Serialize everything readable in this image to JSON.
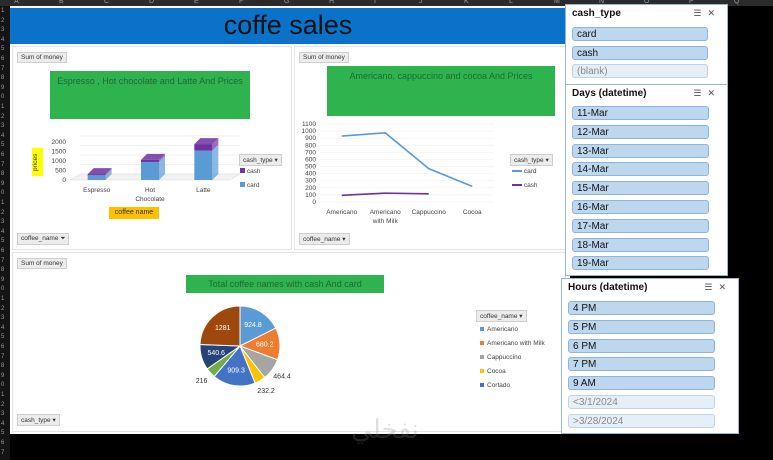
{
  "spreadsheet": {
    "column_letters": [
      "A",
      "B",
      "C",
      "D",
      "E",
      "F",
      "G",
      "H",
      "I",
      "J",
      "K",
      "L",
      "M",
      "N",
      "O",
      "P",
      "Q"
    ],
    "row_numbers": [
      "1",
      "2",
      "3",
      "4",
      "5",
      "6",
      "7",
      "8",
      "9",
      "0",
      "1",
      "2",
      "3",
      "4",
      "5",
      "6",
      "7",
      "8",
      "9",
      "0",
      "1",
      "2",
      "3",
      "4",
      "5",
      "6",
      "7",
      "8",
      "9",
      "0",
      "1",
      "2",
      "3",
      "4",
      "5",
      "6",
      "7",
      "8",
      "9",
      "0",
      "1",
      "2",
      "3",
      "4",
      "5",
      "6",
      "7"
    ]
  },
  "dashboard": {
    "title": "coffe sales",
    "field_sum_of_money": "Sum of money",
    "field_coffee_name": "coffee_name",
    "field_cash_type": "cash_type",
    "filter_glyph": "▾",
    "funnel_glyph": "⏷"
  },
  "chart1": {
    "title": "Espresso , Hot chocolate and Latte And Prices",
    "legend_title": "cash_type",
    "legend_items": [
      "cash",
      "card"
    ],
    "axis_field_button": "coffee name",
    "y_axis_button": "prices"
  },
  "chart2": {
    "title": "Americano, cappuccino and cocoa And Prices",
    "legend_title": "cash_type",
    "legend_items": [
      "card",
      "cash"
    ]
  },
  "chart3": {
    "title": "Total coffee names with cash And card",
    "legend_title": "coffee_name",
    "legend_items": [
      "Americano",
      "Americano with Milk",
      "Cappuccino",
      "Cocoa",
      "Cortado"
    ]
  },
  "chart_data": [
    {
      "type": "bar",
      "variant": "stacked-3d-column",
      "title": "Espresso , Hot chocolate and Latte And Prices",
      "categories": [
        "Espresso",
        "Hot Chocolate",
        "Latte"
      ],
      "series": [
        {
          "name": "card",
          "values": [
            250,
            950,
            1550
          ],
          "color": "#5b9bd5"
        },
        {
          "name": "cash",
          "values": [
            60,
            110,
            340
          ],
          "color": "#7030a0"
        }
      ],
      "ylabel": "prices",
      "xlabel": "coffee name",
      "yticks": [
        0,
        500,
        1000,
        1500,
        2000
      ],
      "ylim": [
        0,
        2000
      ],
      "legend": "right"
    },
    {
      "type": "line",
      "title": "Americano, cappuccino and cocoa And Prices",
      "categories": [
        "Americano",
        "Americano with Milk",
        "Cappuccino",
        "Cocoa"
      ],
      "series": [
        {
          "name": "card",
          "values": [
            930,
            975,
            470,
            220
          ],
          "color": "#5b9bd5"
        },
        {
          "name": "cash",
          "values": [
            95,
            125,
            115,
            null
          ],
          "color": "#7030a0"
        }
      ],
      "yticks": [
        0,
        100,
        200,
        300,
        400,
        500,
        600,
        700,
        800,
        900,
        1000,
        1100
      ],
      "ylim": [
        0,
        1100
      ],
      "legend": "right"
    },
    {
      "type": "pie",
      "title": "Total coffee names with cash And card",
      "slices": [
        {
          "label": "Americano",
          "value": 924.8,
          "color": "#5b9bd5"
        },
        {
          "label": "Americano with Milk",
          "value": 680.2,
          "color": "#ed7d31"
        },
        {
          "label": "Cappuccino",
          "value": 464.4,
          "color": "#a5a5a5"
        },
        {
          "label": "Cocoa",
          "value": 232.2,
          "color": "#ffc000"
        },
        {
          "label": "Cortado",
          "value": 909.3,
          "color": "#4472c4"
        },
        {
          "label": "",
          "value": 216,
          "color": "#70ad47"
        },
        {
          "label": "",
          "value": 540.6,
          "color": "#264478"
        },
        {
          "label": "",
          "value": 1281,
          "color": "#9e480e"
        }
      ],
      "visible_labels": [
        "924.8",
        "680.2",
        "464.4",
        "232.2",
        "909.3",
        "216",
        "540.6",
        "1281"
      ],
      "legend": "right"
    }
  ],
  "slicers": {
    "cash_type": {
      "title": "cash_type",
      "items": [
        {
          "label": "card",
          "selected": true
        },
        {
          "label": "cash",
          "selected": true
        },
        {
          "label": "(blank)",
          "selected": false
        }
      ]
    },
    "days": {
      "title": "Days (datetime)",
      "items": [
        {
          "label": "11-Mar",
          "selected": true
        },
        {
          "label": "12-Mar",
          "selected": true
        },
        {
          "label": "13-Mar",
          "selected": true
        },
        {
          "label": "14-Mar",
          "selected": true
        },
        {
          "label": "15-Mar",
          "selected": true
        },
        {
          "label": "16-Mar",
          "selected": true
        },
        {
          "label": "17-Mar",
          "selected": true
        },
        {
          "label": "18-Mar",
          "selected": true
        },
        {
          "label": "19-Mar",
          "selected": true
        }
      ]
    },
    "hours": {
      "title": "Hours (datetime)",
      "items": [
        {
          "label": "4 PM",
          "selected": true
        },
        {
          "label": "5 PM",
          "selected": true
        },
        {
          "label": "6 PM",
          "selected": true
        },
        {
          "label": "7 PM",
          "selected": true
        },
        {
          "label": "9 AM",
          "selected": true
        },
        {
          "label": "<3/1/2024",
          "selected": false
        },
        {
          "label": ">3/28/2024",
          "selected": false
        }
      ]
    },
    "icon_multiselect": "multi-select-icon",
    "icon_clear": "clear-filter-icon"
  },
  "watermark": {
    "text": "نفخلي"
  }
}
